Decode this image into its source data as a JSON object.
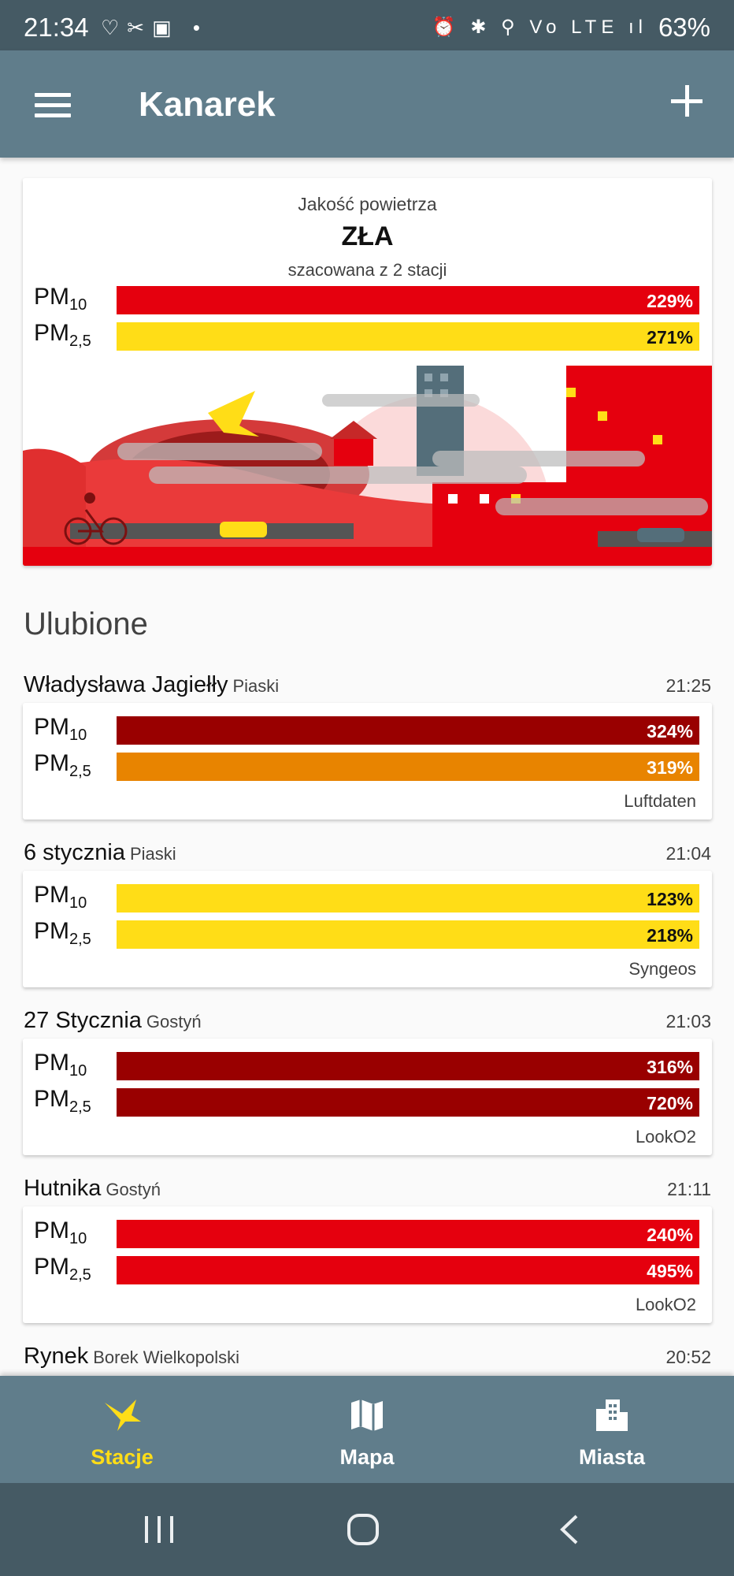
{
  "status_bar": {
    "time": "21:34",
    "left_icons": "♡✂▣ •",
    "right_icons": "⏰ ✱ ⚲ Vo LTE ıl",
    "battery": "63%"
  },
  "app": {
    "title": "Kanarek"
  },
  "summary": {
    "label": "Jakość powietrza",
    "status": "ZŁA",
    "subtitle": "szacowana z 2 stacji",
    "pm10": {
      "name": "PM",
      "sub": "10",
      "value": "229%",
      "color": "#e5000e"
    },
    "pm25": {
      "name": "PM",
      "sub": "2,5",
      "value": "271%",
      "color": "#ffdd17"
    }
  },
  "favorites": {
    "title": "Ulubione",
    "stations": [
      {
        "name": "Władysława Jagiełły",
        "district": "Piaski",
        "time": "21:25",
        "source": "Luftdaten",
        "pm10": {
          "name": "PM",
          "sub": "10",
          "value": "324%",
          "color": "#990000",
          "text": "#ffffff"
        },
        "pm25": {
          "name": "PM",
          "sub": "2,5",
          "value": "319%",
          "color": "#e88400",
          "text": "#ffffff"
        }
      },
      {
        "name": "6 stycznia",
        "district": "Piaski",
        "time": "21:04",
        "source": "Syngeos",
        "pm10": {
          "name": "PM",
          "sub": "10",
          "value": "123%",
          "color": "#ffdd17",
          "text": "#111111"
        },
        "pm25": {
          "name": "PM",
          "sub": "2,5",
          "value": "218%",
          "color": "#ffdd17",
          "text": "#111111"
        }
      },
      {
        "name": "27 Stycznia",
        "district": "Gostyń",
        "time": "21:03",
        "source": "LookO2",
        "pm10": {
          "name": "PM",
          "sub": "10",
          "value": "316%",
          "color": "#990000",
          "text": "#ffffff"
        },
        "pm25": {
          "name": "PM",
          "sub": "2,5",
          "value": "720%",
          "color": "#990000",
          "text": "#ffffff"
        }
      },
      {
        "name": "Hutnika",
        "district": "Gostyń",
        "time": "21:11",
        "source": "LookO2",
        "pm10": {
          "name": "PM",
          "sub": "10",
          "value": "240%",
          "color": "#e5000e",
          "text": "#ffffff"
        },
        "pm25": {
          "name": "PM",
          "sub": "2,5",
          "value": "495%",
          "color": "#e5000e",
          "text": "#ffffff"
        }
      },
      {
        "name": "Rynek",
        "district": "Borek Wielkopolski",
        "time": "20:52"
      }
    ]
  },
  "bottom_nav": {
    "items": [
      {
        "label": "Stacje",
        "icon": "bird-icon",
        "active": true
      },
      {
        "label": "Mapa",
        "icon": "map-icon",
        "active": false
      },
      {
        "label": "Miasta",
        "icon": "city-icon",
        "active": false
      }
    ],
    "active_color": "#ffdd17"
  },
  "system_nav": {
    "icons": [
      "recent-apps-icon",
      "home-icon",
      "back-icon"
    ]
  }
}
